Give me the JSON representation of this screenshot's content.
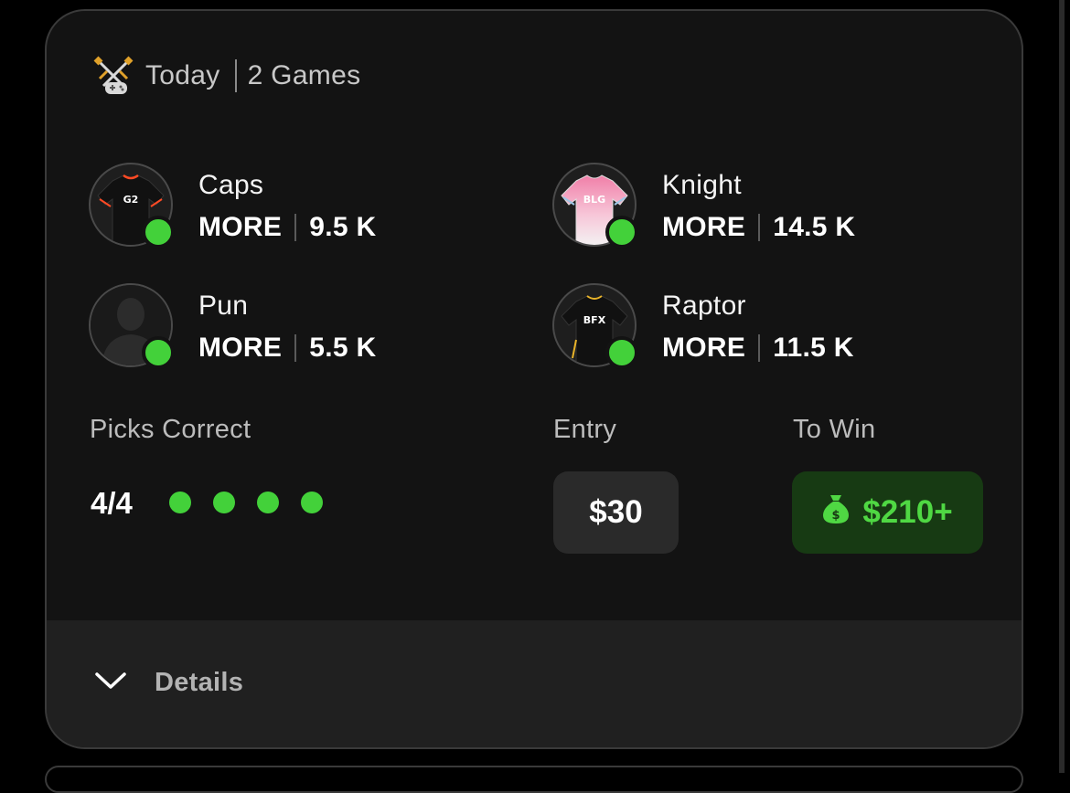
{
  "header": {
    "day": "Today",
    "games": "2 Games",
    "icon": "crossed-swords-gamepad-icon"
  },
  "players": [
    {
      "name": "Caps",
      "pick": "MORE",
      "line": "9.5 K",
      "jersey_text": "G2",
      "jersey_color": "#111111",
      "status": "active"
    },
    {
      "name": "Knight",
      "pick": "MORE",
      "line": "14.5 K",
      "jersey_text": "BLG",
      "jersey_color": "#f07fa8",
      "status": "active"
    },
    {
      "name": "Pun",
      "pick": "MORE",
      "line": "5.5 K",
      "jersey_text": "",
      "jersey_color": "",
      "status": "active"
    },
    {
      "name": "Raptor",
      "pick": "MORE",
      "line": "11.5 K",
      "jersey_text": "BFX",
      "jersey_color": "#111111",
      "status": "active"
    }
  ],
  "picks": {
    "label": "Picks Correct",
    "value": "4/4",
    "correct": 4,
    "total": 4
  },
  "entry": {
    "label": "Entry",
    "amount": "$30"
  },
  "to_win": {
    "label": "To Win",
    "amount": "$210+",
    "icon": "money-bag-icon"
  },
  "footer": {
    "details_label": "Details",
    "icon": "chevron-down-icon"
  },
  "colors": {
    "card_bg": "#131313",
    "footer_bg": "#202020",
    "accent_green": "#43d13a",
    "win_bg": "#173a13"
  }
}
